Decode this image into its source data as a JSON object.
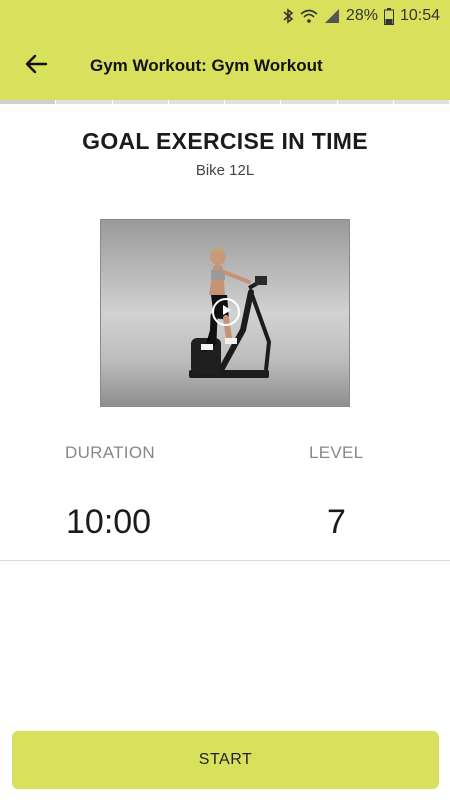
{
  "status_bar": {
    "battery_percent": "28%",
    "time": "10:54",
    "icons": [
      "bluetooth-icon",
      "wifi-icon",
      "signal-icon",
      "battery-icon"
    ]
  },
  "app_bar": {
    "title": "Gym Workout: Gym Workout",
    "back_icon": "arrow-left-icon"
  },
  "progress": {
    "segments": 8,
    "current": 1
  },
  "exercise": {
    "heading": "GOAL EXERCISE IN TIME",
    "equipment": "Bike 12L",
    "media_icon": "play-icon"
  },
  "stats": {
    "duration_label": "DURATION",
    "duration_value": "10:00",
    "level_label": "LEVEL",
    "level_value": "7"
  },
  "actions": {
    "start_label": "START"
  },
  "colors": {
    "accent": "#d9e05c",
    "text": "#1b1b1b",
    "muted": "#888888"
  }
}
